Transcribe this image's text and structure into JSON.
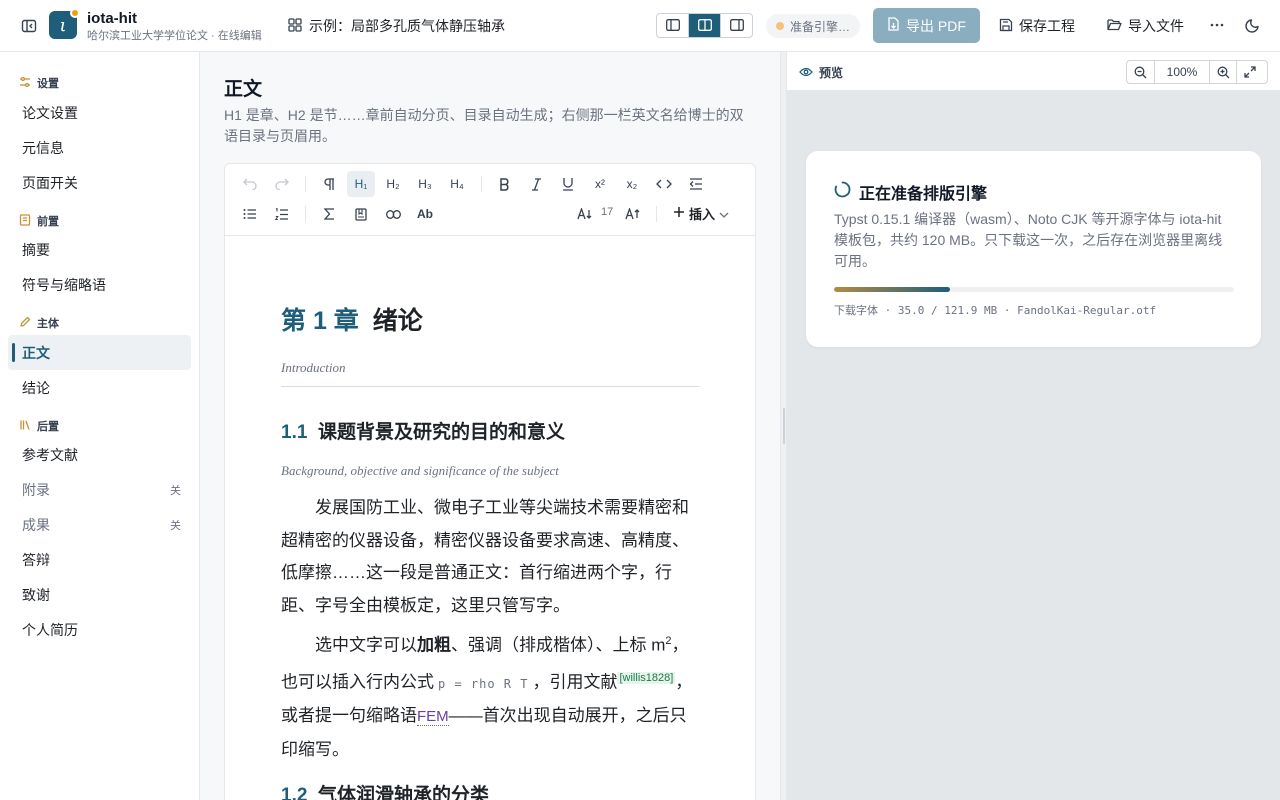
{
  "app": {
    "name": "iota-hit",
    "subtitle": "哈尔滨工业大学学位论文 · 在线编辑",
    "logo_letter": "ι",
    "project_title": "示例：局部多孔质气体静压轴承",
    "status_text": "准备引擎…",
    "export_label": "导出 PDF",
    "save_label": "保存工程",
    "import_label": "导入文件",
    "accent_color": "#1f5e7a",
    "status_dot_color": "#f5c27b"
  },
  "sidebar": {
    "sections": [
      {
        "label": "设置",
        "icon": "sliders-icon"
      },
      {
        "label": "前置",
        "icon": "book-icon"
      },
      {
        "label": "主体",
        "icon": "pen-icon"
      },
      {
        "label": "后置",
        "icon": "library-icon"
      }
    ],
    "items": [
      {
        "label": "论文设置"
      },
      {
        "label": "元信息"
      },
      {
        "label": "页面开关"
      },
      {
        "label": "摘要"
      },
      {
        "label": "符号与缩略语"
      },
      {
        "label": "正文",
        "active": true
      },
      {
        "label": "结论"
      },
      {
        "label": "参考文献"
      },
      {
        "label": "附录",
        "tag": "关"
      },
      {
        "label": "成果",
        "tag": "关"
      },
      {
        "label": "答辩"
      },
      {
        "label": "致谢"
      },
      {
        "label": "个人简历"
      }
    ]
  },
  "editor": {
    "title": "正文",
    "description": "H1 是章、H2 是节……章前自动分页、目录自动生成；右侧那一栏英文名给博士的双语目录与页眉用。",
    "toolbar": {
      "h1": "H₁",
      "h2": "H₂",
      "h3": "H₃",
      "h4": "H₄",
      "sup": "x²",
      "sub": "x₂",
      "font_size": "17",
      "case_label": "Ab",
      "insert_label": "插入"
    },
    "doc": {
      "chapter_num": "第 1 章",
      "chapter_title": "绪论",
      "chapter_en": "Introduction",
      "section_num": "1.1",
      "section_title": "课题背景及研究的目的和意义",
      "section_en": "Background, objective and significance of the subject",
      "para1": "发展国防工业、微电子工业等尖端技术需要精密和超精密的仪器设备，精密仪器设备要求高速、高精度、低摩擦……这一段是普通正文：首行缩进两个字，行距、字号全由模板定，这里只管写字。",
      "para2_a": "选中文字可以",
      "para2_bold": "加粗",
      "para2_b": "、强调（排成楷体）、上标 m",
      "para2_sup": "2",
      "para2_c": "，也可以插入行内公式",
      "para2_code": "p = rho R T",
      "para2_d": "，引用文献",
      "para2_cite": "[willis1828]",
      "para2_e": "，或者提一句缩略语",
      "para2_abbr": "FEM",
      "para2_f": "——首次出现自动展开，之后只印缩写。",
      "section2_num": "1.2",
      "section2_title": "气体润滑轴承的分类"
    }
  },
  "preview": {
    "label": "预览",
    "zoom": "100%",
    "engine_title": "正在准备排版引擎",
    "engine_desc": "Typst 0.15.1 编译器（wasm）、Noto CJK 等开源字体与 iota-hit 模板包，共约 120 MB。只下载这一次，之后存在浏览器里离线可用。",
    "progress_fraction": 0.289,
    "progress_text": "下载字体 · 35.0 / 121.9 MB · FandolKai-Regular.otf"
  }
}
